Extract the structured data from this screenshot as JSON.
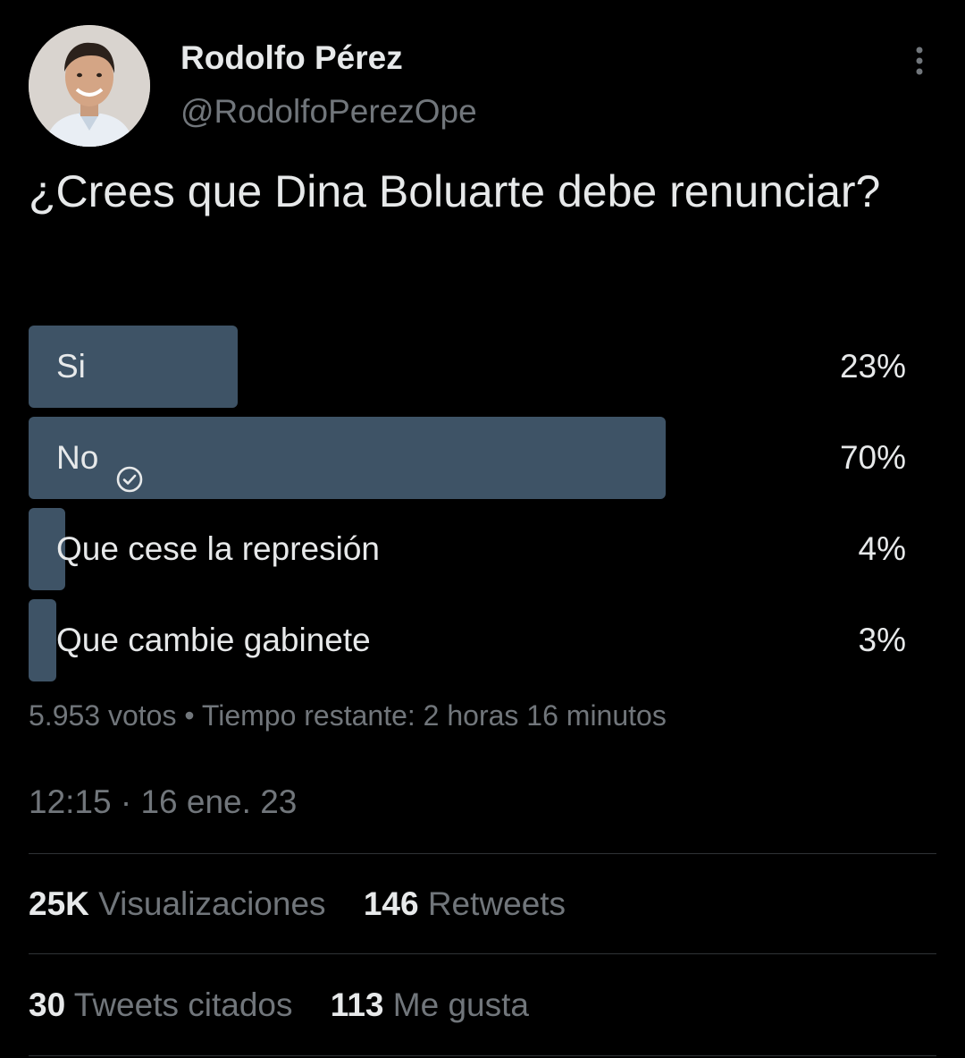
{
  "author": {
    "name": "Rodolfo Pérez",
    "handle": "@RodolfoPerezOpe",
    "avatar_icon": "profile-photo"
  },
  "tweet": {
    "text": "¿Crees que Dina Boluarte debe renunciar?"
  },
  "poll": {
    "options": [
      {
        "label": "Si",
        "percent_text": "23%",
        "percent": 23,
        "winner": false
      },
      {
        "label": "No",
        "percent_text": "70%",
        "percent": 70,
        "winner": true
      },
      {
        "label": "Que cese la represión",
        "percent_text": "4%",
        "percent": 4,
        "winner": false
      },
      {
        "label": "Que cambie gabinete",
        "percent_text": "3%",
        "percent": 3,
        "winner": false
      }
    ],
    "votes": "5.953 votos",
    "separator": "•",
    "time_left": "Tiempo restante: 2 horas 16 minutos"
  },
  "timestamp": "12:15 · 16 ene. 23",
  "stats": {
    "views_count": "25K",
    "views_label": "Visualizaciones",
    "retweets_count": "146",
    "retweets_label": "Retweets",
    "quotes_count": "30",
    "quotes_label": "Tweets citados",
    "likes_count": "113",
    "likes_label": "Me gusta"
  },
  "colors": {
    "background": "#000000",
    "text_primary": "#e7e9ea",
    "text_secondary": "#71767b",
    "poll_bar": "#3e5366",
    "divider": "#2f3336"
  },
  "icons": {
    "more": "more-vertical-icon",
    "winner_check": "check-circle-icon"
  }
}
